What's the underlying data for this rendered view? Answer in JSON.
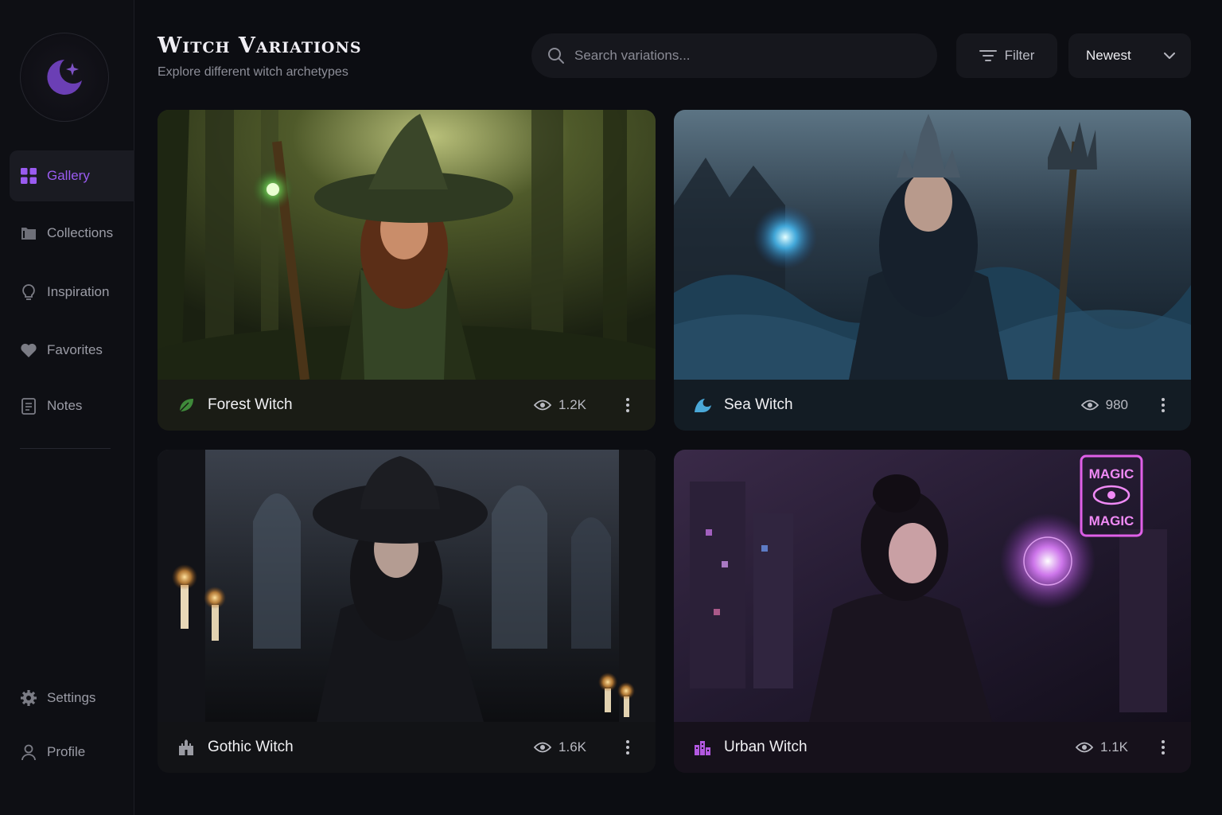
{
  "header": {
    "title": "Witch Variations",
    "subtitle": "Explore different witch archetypes"
  },
  "search": {
    "placeholder": "Search variations...",
    "value": ""
  },
  "filter": {
    "label": "Filter"
  },
  "sort": {
    "selected": "Newest"
  },
  "sidebar": {
    "logo_icon": "crescent-moon-star-icon",
    "items": [
      {
        "label": "Gallery",
        "icon": "grid-icon",
        "active": true
      },
      {
        "label": "Collections",
        "icon": "folder-icon"
      },
      {
        "label": "Inspiration",
        "icon": "lightbulb-icon"
      },
      {
        "label": "Favorites",
        "icon": "heart-icon"
      },
      {
        "label": "Notes",
        "icon": "notepad-icon"
      }
    ],
    "bottom": [
      {
        "label": "Settings",
        "icon": "gear-icon"
      },
      {
        "label": "Profile",
        "icon": "user-icon"
      }
    ]
  },
  "cards": [
    {
      "name": "Forest Witch",
      "views": "1.2K",
      "icon": "leaf-icon"
    },
    {
      "name": "Sea Witch",
      "views": "980",
      "icon": "wave-icon"
    },
    {
      "name": "Gothic Witch",
      "views": "1.6K",
      "icon": "castle-icon"
    },
    {
      "name": "Urban Witch",
      "views": "1.1K",
      "icon": "city-icon"
    }
  ],
  "urban_sign": {
    "line1": "MAGIC",
    "line2": "MAGIC"
  },
  "colors": {
    "accent": "#9a5bf0",
    "background": "#0c0d12",
    "sidebar": "#0e0f14",
    "card_bar": "#14151b"
  }
}
